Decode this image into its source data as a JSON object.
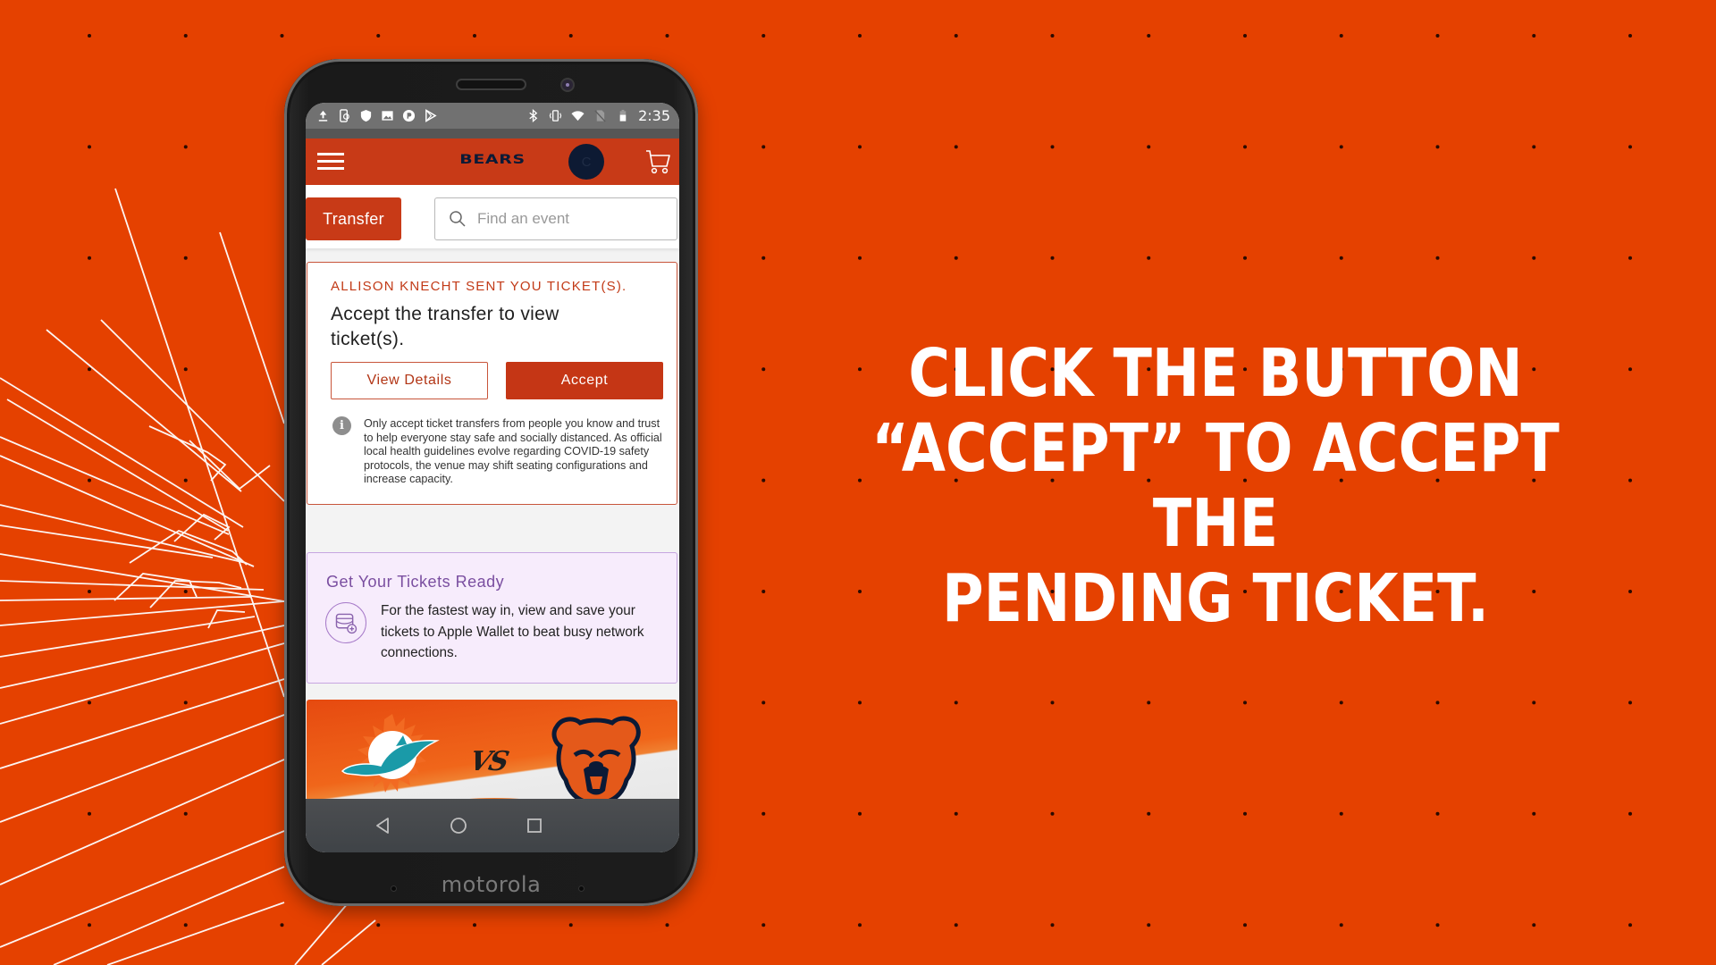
{
  "background": {
    "color": "#e54100",
    "dot_color": "#2a0a00"
  },
  "headline": {
    "lines": [
      "CLICK THE BUTTON",
      "“ACCEPT” TO ACCEPT THE",
      "PENDING TICKET."
    ]
  },
  "phone": {
    "brand": "motorola",
    "status_bar": {
      "left_icons": [
        "upload-icon",
        "phone-sync-icon",
        "shield-icon",
        "image-icon",
        "pandora-icon",
        "play-store-icon"
      ],
      "right_icons": [
        "bluetooth-icon",
        "vibrate-icon",
        "wifi-icon",
        "no-sim-icon",
        "battery-icon"
      ],
      "time": "2:35"
    },
    "app": {
      "header": {
        "logo_text": "BEARS",
        "avatar_initial": "C",
        "menu_icon": "hamburger-icon",
        "cart_icon": "cart-icon",
        "brand_color": "#c83a17",
        "logo_color": "#0b1a36"
      },
      "toolbar": {
        "transfer_label": "Transfer",
        "search_placeholder": "Find an event",
        "search_value": ""
      },
      "transfer_card": {
        "sender_line": "ALLISON KNECHT SENT YOU TICKET(S).",
        "message": "Accept the transfer to view ticket(s).",
        "view_details_label": "View Details",
        "accept_label": "Accept",
        "info_icon": "info-icon",
        "note": "Only accept ticket transfers from people you know and trust to help everyone stay safe and socially distanced. As official local health guidelines evolve regarding COVID-19 safety protocols, the venue may shift seating configurations and increase capacity."
      },
      "ready_card": {
        "title": "Get Your Tickets Ready",
        "icon": "wallet-add-icon",
        "text": "For the fastest way in, view and save your tickets to Apple Wallet to beat busy network connections."
      },
      "game_banner": {
        "home_logo": "dolphins-logo",
        "versus": "VS",
        "away_logo": "bears-logo"
      }
    },
    "nav_bar": {
      "back_icon": "back-icon",
      "home_icon": "home-icon",
      "recents_icon": "recents-icon"
    }
  }
}
